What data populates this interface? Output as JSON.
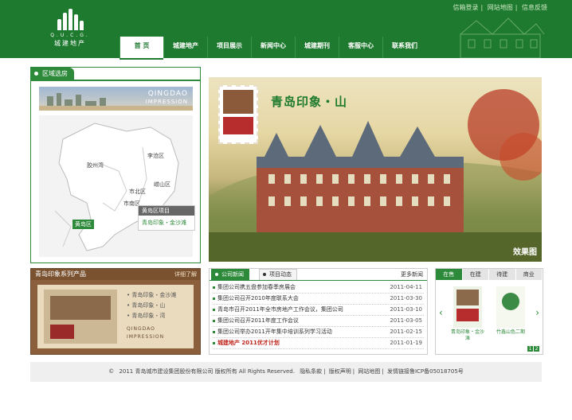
{
  "header": {
    "logo_abbr": "Q.U.C.G.",
    "logo_name": "城建地产",
    "top_links": [
      "信箱登录",
      "网站地图",
      "信息反馈"
    ],
    "nav": [
      "首 页",
      "城建地产",
      "项目展示",
      "新闻中心",
      "城建期刊",
      "客服中心",
      "联系我们"
    ],
    "colors": {
      "brand": "#1e7a2e",
      "accent": "#2e8a3b"
    }
  },
  "region": {
    "tab_label": "区域选房",
    "city_text_1": "QINGDAO",
    "city_text_2": "IMPRESSION",
    "districts": [
      "胶州湾",
      "李沧区",
      "崂山区",
      "市北区",
      "市南区"
    ],
    "huangdao_label": "黄岛区",
    "project_box": {
      "title": "黄岛区项目",
      "item": "青岛印象・金沙滩"
    }
  },
  "banner": {
    "title": "青岛印象・山",
    "effect_label": "效果图"
  },
  "series": {
    "title": "青岛印象系列产品",
    "more": "详细了解",
    "items": [
      "青岛印象・金沙滩",
      "青岛印象・山",
      "青岛印象・湾"
    ],
    "stamp_line1": "QINGDAO",
    "stamp_line2": "IMPRESSION"
  },
  "news": {
    "tabs": [
      "公司新闻",
      "项目动态"
    ],
    "more": "更多新闻",
    "items": [
      {
        "title": "集团公司携五盘参加春季房展会",
        "date": "2011-04-11"
      },
      {
        "title": "集团公司召开2010年度联系大会",
        "date": "2011-03-30"
      },
      {
        "title": "青岛市召开2011年全市房地产工作会议，集团公司",
        "date": "2011-03-10"
      },
      {
        "title": "集团公司召开2011年度工作会议",
        "date": "2011-03-05"
      },
      {
        "title": "集团公司举办2011开年集中培训系列学习活动",
        "date": "2011-02-15"
      },
      {
        "title": "城建地产 2011优才计划",
        "date": "2011-01-19"
      }
    ]
  },
  "sale": {
    "tabs": [
      "在售",
      "在建",
      "待建",
      "商业"
    ],
    "cards": [
      {
        "caption": "青岛印象・金沙滩"
      },
      {
        "caption": "竹鑫山色二期"
      }
    ],
    "pager": [
      "1",
      "2"
    ]
  },
  "footer": {
    "copyright": "2011  青岛城市建设集团股份有限公司 版权所有 All Rights Reserved.",
    "links": [
      "隐私条款",
      "版权声明",
      "网站地图"
    ],
    "icp": "发情链接鲁ICP备05018705号"
  }
}
